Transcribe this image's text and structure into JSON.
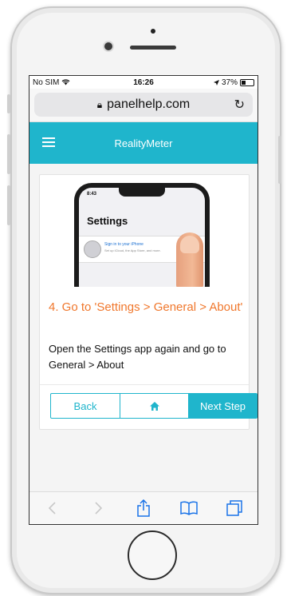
{
  "status_bar": {
    "carrier": "No SIM",
    "time": "16:26",
    "battery": "37%"
  },
  "browser": {
    "url": "panelhelp.com"
  },
  "app": {
    "title": "RealityMeter"
  },
  "illustration": {
    "mock_time": "8:43",
    "mock_title": "Settings",
    "mock_signin": "Sign in to your iPhone",
    "mock_subtitle": "Set up iCloud, the App Store, and more."
  },
  "step": {
    "title": "4. Go to 'Settings > General > About'",
    "description": "Open the Settings app again and go to General > About"
  },
  "buttons": {
    "back": "Back",
    "next": "Next Step"
  },
  "colors": {
    "accent": "#1fb5cc",
    "title_orange": "#f0772c",
    "toolbar_blue": "#1a73e8"
  },
  "icons": {
    "wifi": "wifi-icon",
    "location": "location-arrow-icon",
    "battery": "battery-icon",
    "lock": "lock-icon",
    "reload": "reload-icon",
    "menu": "hamburger-menu-icon",
    "home": "home-icon",
    "back": "chevron-left-icon",
    "forward": "chevron-right-icon",
    "share": "share-icon",
    "bookmarks": "book-icon",
    "tabs": "tabs-icon"
  }
}
